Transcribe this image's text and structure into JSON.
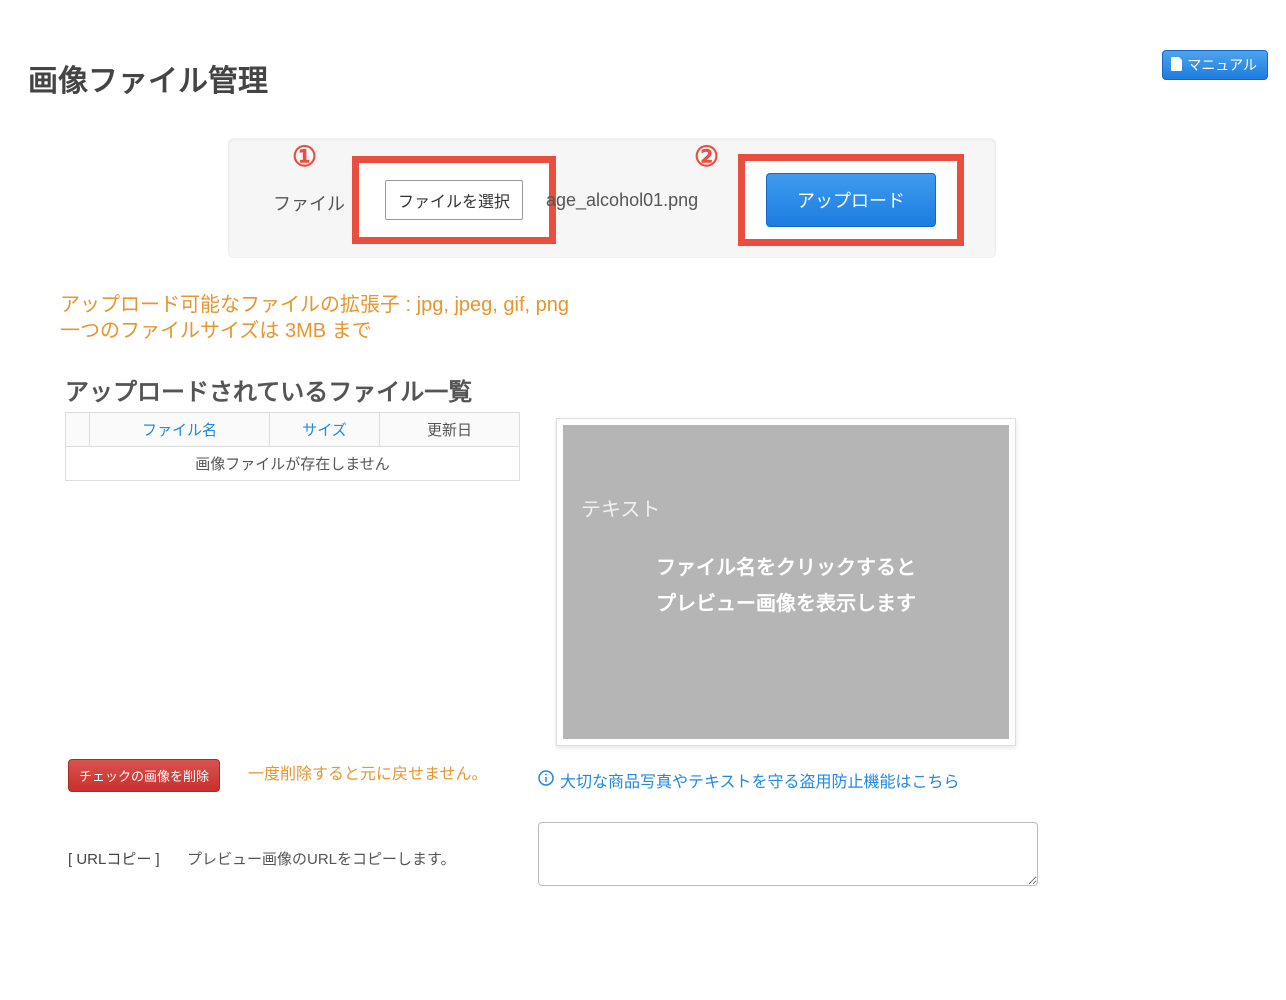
{
  "header": {
    "manual_label": "マニュアル"
  },
  "page": {
    "title": "画像ファイル管理"
  },
  "upload": {
    "callout1": "①",
    "callout2": "②",
    "file_label": "ファイル",
    "choose_label": "ファイルを選択",
    "filename": "age_alcohol01.png",
    "upload_label": "アップロード"
  },
  "help": {
    "line1": "アップロード可能なファイルの拡張子 : jpg, jpeg, gif, png",
    "line2": "一つのファイルサイズは 3MB まで"
  },
  "list": {
    "section_title": "アップロードされているファイル一覧",
    "cols": {
      "name": "ファイル名",
      "size": "サイズ",
      "date": "更新日"
    },
    "empty": "画像ファイルが存在しません"
  },
  "preview": {
    "text_label": "テキスト",
    "msg1": "ファイル名をクリックすると",
    "msg2": "プレビュー画像を表示します"
  },
  "delete": {
    "btn_label": "チェックの画像を削除",
    "warn": "一度削除すると元に戻せません。"
  },
  "theft": {
    "link": "大切な商品写真やテキストを守る盗用防止機能はこちら"
  },
  "urlcopy": {
    "label": "[ URLコピー ]",
    "desc": "プレビュー画像のURLをコピーします。"
  }
}
